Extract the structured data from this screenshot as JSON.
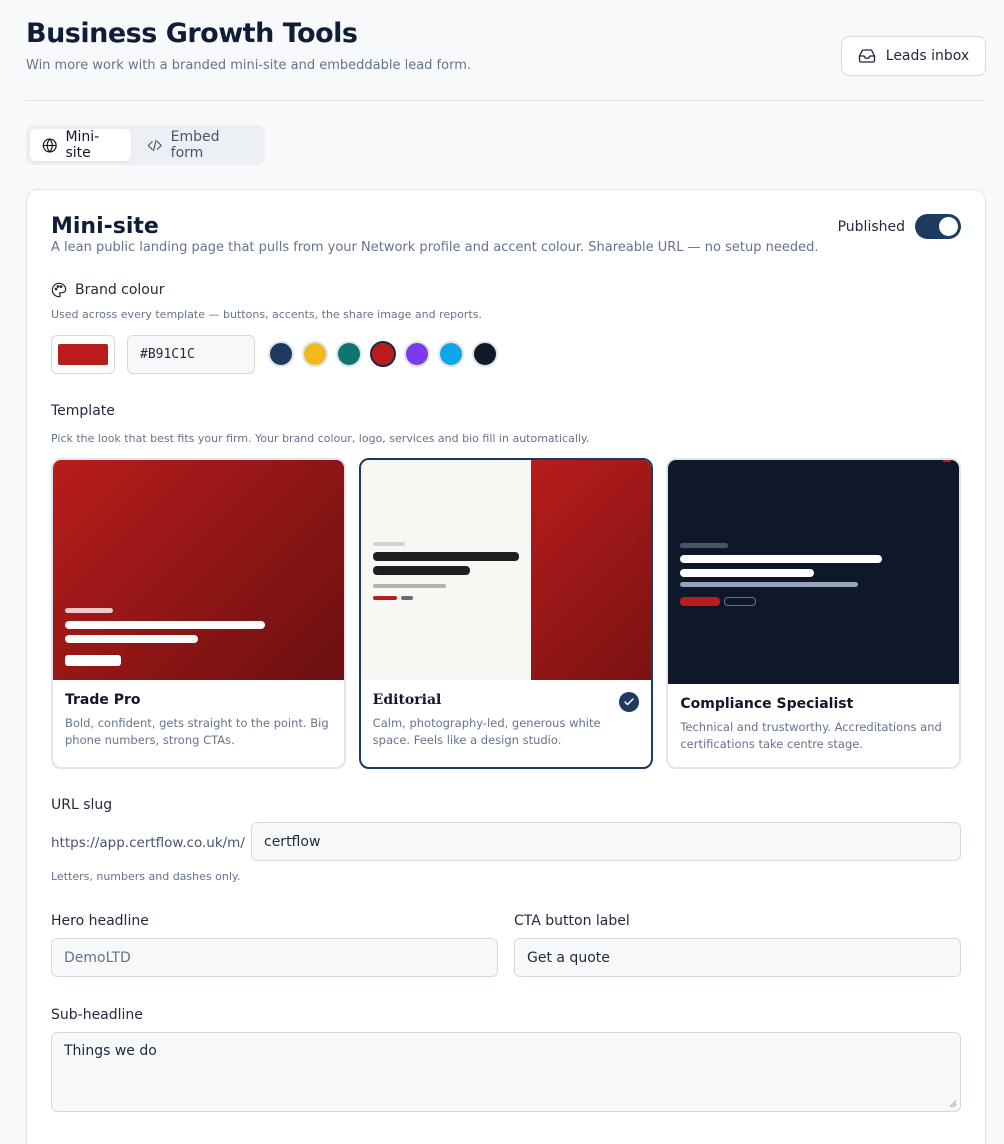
{
  "header": {
    "title": "Business Growth Tools",
    "subtitle": "Win more work with a branded mini-site and embeddable lead form.",
    "leads_button": "Leads inbox"
  },
  "tabs": [
    {
      "label": "Mini-site",
      "active": true,
      "icon": "globe-icon"
    },
    {
      "label": "Embed form",
      "active": false,
      "icon": "code-icon"
    }
  ],
  "minisite": {
    "title": "Mini-site",
    "description": "A lean public landing page that pulls from your Network profile and accent colour. Shareable URL — no setup needed.",
    "published_label": "Published",
    "published": true
  },
  "brand": {
    "label": "Brand colour",
    "hint": "Used across every template — buttons, accents, the share image and reports.",
    "hex_value": "#B91C1C",
    "current_color": "#B91C1C",
    "presets": [
      "#1e3a5f",
      "#f2b91f",
      "#0f766e",
      "#b91c1c",
      "#7c3aed",
      "#0ea5e9",
      "#111827"
    ],
    "selected_index": 3
  },
  "template": {
    "label": "Template",
    "hint": "Pick the look that best fits your firm. Your brand colour, logo, services and bio fill in automatically.",
    "options": [
      {
        "name": "Trade Pro",
        "desc": "Bold, confident, gets straight to the point. Big phone numbers, strong CTAs.",
        "selected": false
      },
      {
        "name": "Editorial",
        "desc": "Calm, photography-led, generous white space. Feels like a design studio.",
        "selected": true
      },
      {
        "name": "Compliance Specialist",
        "desc": "Technical and trustworthy. Accreditations and certifications take centre stage.",
        "selected": false
      }
    ]
  },
  "slug": {
    "label": "URL slug",
    "prefix": "https://app.certflow.co.uk/m/",
    "value": "certflow",
    "hint": "Letters, numbers and dashes only."
  },
  "hero": {
    "label": "Hero headline",
    "placeholder": "DemoLTD"
  },
  "cta": {
    "label": "CTA button label",
    "value": "Get a quote"
  },
  "subheadline": {
    "label": "Sub-headline",
    "value": "Things we do"
  }
}
